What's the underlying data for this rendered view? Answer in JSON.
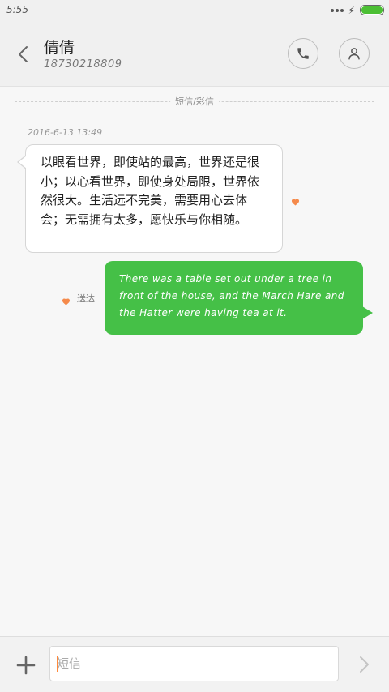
{
  "status_bar": {
    "time": "5:55",
    "battery_level": 1.0,
    "battery_color": "#4cbf34"
  },
  "header": {
    "contact_name": "倩倩",
    "contact_number": "18730218809",
    "back_icon": "chevron-left-icon",
    "call_icon": "phone-icon",
    "contact_icon": "person-icon"
  },
  "conversation": {
    "channel_label": "短信/彩信",
    "timestamp": "2016-6-13 13:49",
    "incoming": {
      "text": "以眼看世界，即使站的最高，世界还是很小；以心看世界，即使身处局限，世界依然很大。生活远不完美，需要用心去体会；无需拥有太多，愿快乐与你相随。"
    },
    "outgoing": {
      "text": "There was a table set out under a tree in front of the house, and the March Hare and the Hatter were having tea at it.",
      "status": "送达"
    },
    "favorite_icon": "heart-icon",
    "favorite_color": "#f58a4b",
    "outgoing_bubble_color": "#45c047"
  },
  "composer": {
    "placeholder": "短信",
    "value": "",
    "add_icon": "plus-icon",
    "send_icon": "chevron-right-icon"
  }
}
